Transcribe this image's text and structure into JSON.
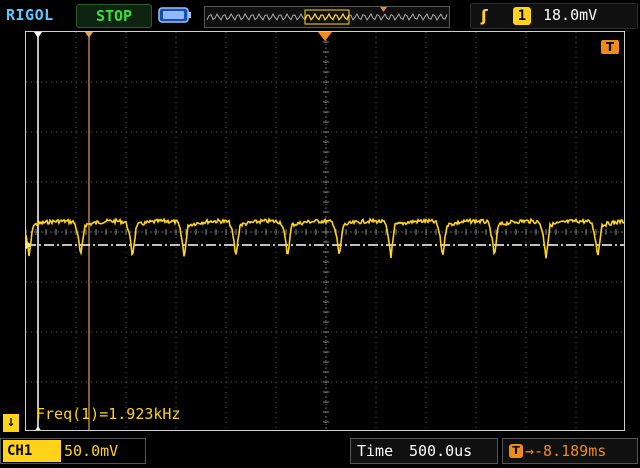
{
  "header": {
    "brand": "RIGOL",
    "run_state": "STOP",
    "battery_icon": "battery-icon",
    "trigger_slope_glyph": "ʃ",
    "trigger_source": "1",
    "trigger_level": "18.0mV"
  },
  "measurement": {
    "text": "Freq(1)=1.923kHz"
  },
  "channel": {
    "badge": "CH1",
    "scale": "50.0mV"
  },
  "timebase": {
    "label": "Time",
    "value": "500.0us"
  },
  "trigger_delay": {
    "icon": "T",
    "value": "→-8.189ms"
  },
  "markers": {
    "trigger_level_marker": "T",
    "channel_ground_marker": "↓"
  },
  "colors": {
    "ch1": "#ffd31a",
    "trigger": "#f08a18",
    "brand": "#5fc7ff",
    "stop": "#38e038",
    "grid": "#5a5a5a"
  },
  "waveform": {
    "frequency_khz": 1.923,
    "period_us": 520,
    "cycles_visible": 11.5
  }
}
